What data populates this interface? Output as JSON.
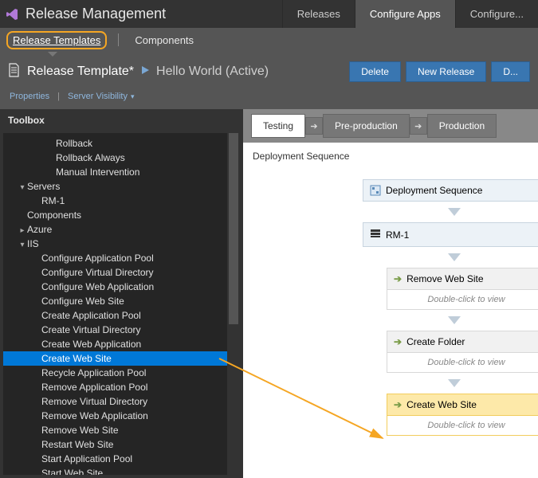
{
  "titlebar": {
    "title": "Release Management",
    "tabs": [
      {
        "label": "Releases",
        "active": false
      },
      {
        "label": "Configure Apps",
        "active": true
      },
      {
        "label": "Configure...",
        "active": false
      }
    ]
  },
  "subnav": {
    "active": "Release Templates",
    "other": "Components"
  },
  "template": {
    "name": "Release Template*",
    "subtitle": "Hello World (Active)",
    "buttons": {
      "delete": "Delete",
      "new": "New Release",
      "more": "D..."
    }
  },
  "propsRow": {
    "properties": "Properties",
    "visibility": "Server Visibility"
  },
  "toolbox": {
    "header": "Toolbox",
    "items": [
      {
        "label": "Rollback",
        "indent": 3
      },
      {
        "label": "Rollback Always",
        "indent": 3
      },
      {
        "label": "Manual Intervention",
        "indent": 3
      },
      {
        "label": "Servers",
        "indent": 1,
        "expander": "▾"
      },
      {
        "label": "RM-1",
        "indent": 2
      },
      {
        "label": "Components",
        "indent": 1
      },
      {
        "label": "Azure",
        "indent": 1,
        "expander": "▸"
      },
      {
        "label": "IIS",
        "indent": 1,
        "expander": "▾"
      },
      {
        "label": "Configure Application Pool",
        "indent": 2
      },
      {
        "label": "Configure Virtual Directory",
        "indent": 2
      },
      {
        "label": "Configure Web Application",
        "indent": 2
      },
      {
        "label": "Configure Web Site",
        "indent": 2
      },
      {
        "label": "Create Application Pool",
        "indent": 2
      },
      {
        "label": "Create Virtual Directory",
        "indent": 2
      },
      {
        "label": "Create Web Application",
        "indent": 2
      },
      {
        "label": "Create Web Site",
        "indent": 2,
        "selected": true
      },
      {
        "label": "Recycle Application Pool",
        "indent": 2
      },
      {
        "label": "Remove Application Pool",
        "indent": 2
      },
      {
        "label": "Remove Virtual Directory",
        "indent": 2
      },
      {
        "label": "Remove Web Application",
        "indent": 2
      },
      {
        "label": "Remove Web Site",
        "indent": 2
      },
      {
        "label": "Restart Web Site",
        "indent": 2
      },
      {
        "label": "Start Application Pool",
        "indent": 2
      },
      {
        "label": "Start Web Site",
        "indent": 2
      }
    ]
  },
  "stages": [
    {
      "label": "Testing",
      "active": true
    },
    {
      "label": "Pre-production",
      "active": false
    },
    {
      "label": "Production",
      "active": false
    }
  ],
  "canvas": {
    "title": "Deployment Sequence",
    "seqHeader": "Deployment Sequence",
    "serverHeader": "RM-1",
    "activities": [
      {
        "title": "Remove Web Site",
        "body": "Double-click to view",
        "highlight": false
      },
      {
        "title": "Create Folder",
        "body": "Double-click to view",
        "highlight": false
      },
      {
        "title": "Create Web Site",
        "body": "Double-click to view",
        "highlight": true
      }
    ]
  }
}
